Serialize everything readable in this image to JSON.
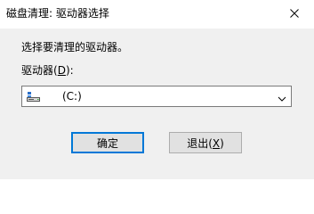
{
  "window": {
    "title": "磁盘清理: 驱动器选择"
  },
  "dialog": {
    "instruction": "选择要清理的驱动器。",
    "drive_label_prefix": "驱动器(",
    "drive_label_mnemonic": "D",
    "drive_label_suffix": "):",
    "selected_drive": "(C:)",
    "ok_label": "确定",
    "cancel_label_prefix": "退出(",
    "cancel_label_mnemonic": "X",
    "cancel_label_suffix": ")"
  },
  "icons": {
    "close": "close-icon",
    "drive": "drive-icon",
    "dropdown": "chevron-down-icon"
  },
  "colors": {
    "accent": "#0078d7",
    "content_background": "#f0f0f0",
    "button_face": "#e1e1e1"
  }
}
